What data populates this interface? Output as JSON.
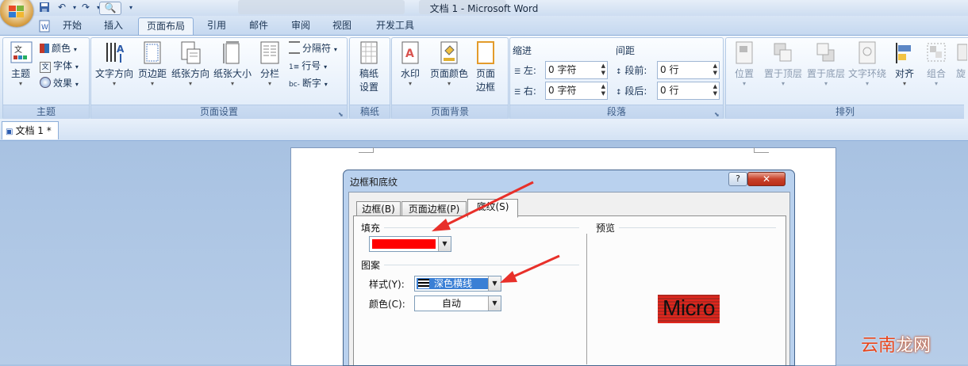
{
  "window": {
    "title": "文档 1 - Microsoft Word"
  },
  "qat": {
    "undo_icon": "undo-icon",
    "redo_icon": "redo-icon",
    "save_icon": "save-icon"
  },
  "tabs": [
    "开始",
    "插入",
    "页面布局",
    "引用",
    "邮件",
    "审阅",
    "视图",
    "开发工具"
  ],
  "active_tab": "页面布局",
  "ribbon": {
    "theme": {
      "label": "主题",
      "themes_btn": "主题",
      "colors": "颜色",
      "fonts": "字体",
      "effects": "效果"
    },
    "page_setup": {
      "label": "页面设置",
      "text_direction": "文字方向",
      "margins": "页边距",
      "orientation": "纸张方向",
      "size": "纸张大小",
      "columns": "分栏",
      "breaks": "分隔符",
      "line_numbers": "行号",
      "hyphenation": "断字"
    },
    "manuscript": {
      "label": "稿纸",
      "settings_l1": "稿纸",
      "settings_l2": "设置"
    },
    "page_background": {
      "label": "页面背景",
      "watermark": "水印",
      "page_color": "页面颜色",
      "borders_l1": "页面",
      "borders_l2": "边框"
    },
    "paragraph": {
      "label": "段落",
      "indent": "缩进",
      "left": "左:",
      "left_val": "0 字符",
      "right": "右:",
      "right_val": "0 字符",
      "spacing": "间距",
      "before": "段前:",
      "before_val": "0 行",
      "after": "段后:",
      "after_val": "0 行"
    },
    "arrange": {
      "label": "排列",
      "position": "位置",
      "bring_front": "置于顶层",
      "send_back": "置于底层",
      "text_wrap": "文字环绕",
      "align": "对齐",
      "group": "组合",
      "rotate": "旋"
    }
  },
  "document_tab": "文档 1 *",
  "dialog": {
    "title": "边框和底纹",
    "help": "?",
    "close": "✕",
    "tabs": [
      "边框(B)",
      "页面边框(P)",
      "底纹(S)"
    ],
    "fill_label": "填充",
    "fill_color": "#ff0000",
    "pattern_label": "图案",
    "style_label": "样式(Y):",
    "style_value": "深色横线",
    "color_label": "颜色(C):",
    "color_value": "自动",
    "preview_label": "预览",
    "preview_text": "Micro"
  },
  "watermark": {
    "part1": "云南",
    "part2": "龙网"
  }
}
